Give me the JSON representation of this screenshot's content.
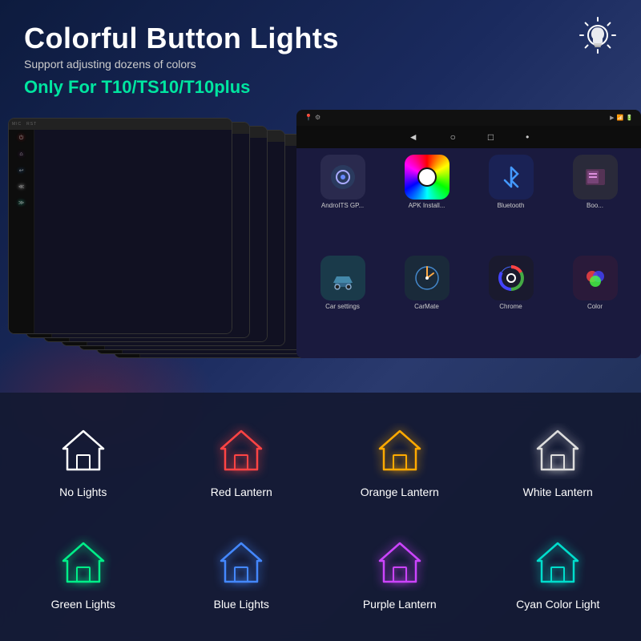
{
  "header": {
    "title": "Colorful Button Lights",
    "subtitle": "Support adjusting dozens of colors",
    "compatible": "Only For T10/TS10/T10plus"
  },
  "lights": [
    {
      "id": "no-lights",
      "label": "No Lights",
      "color": "#ffffff",
      "row": 1
    },
    {
      "id": "red-lantern",
      "label": "Red Lantern",
      "color": "#ff4444",
      "row": 1
    },
    {
      "id": "orange-lantern",
      "label": "Orange Lantern",
      "color": "#ffaa00",
      "row": 1
    },
    {
      "id": "white-lantern",
      "label": "White Lantern",
      "color": "#dddddd",
      "row": 1
    },
    {
      "id": "green-lights",
      "label": "Green Lights",
      "color": "#00ee88",
      "row": 2
    },
    {
      "id": "blue-lights",
      "label": "Blue Lights",
      "color": "#4488ff",
      "row": 2
    },
    {
      "id": "purple-lantern",
      "label": "Purple Lantern",
      "color": "#cc44ff",
      "row": 2
    },
    {
      "id": "cyan-color-light",
      "label": "Cyan Color Light",
      "color": "#00ddcc",
      "row": 2
    }
  ],
  "android": {
    "nav_back": "◄",
    "nav_home": "○",
    "nav_recent": "□",
    "nav_dot": "•",
    "apps": [
      {
        "label": "AndroITS GP...",
        "bg": "#1a1a2e",
        "emoji": "⚙"
      },
      {
        "label": "APK Install...",
        "bg": "#2a4a2a",
        "emoji": "🤖"
      },
      {
        "label": "Bluetooth",
        "bg": "#1a2a4a",
        "emoji": "⬡"
      },
      {
        "label": "Boo...",
        "bg": "#2a2a2a",
        "emoji": "📚"
      },
      {
        "label": "Car settings",
        "bg": "#1a3a4a",
        "emoji": "🚗"
      },
      {
        "label": "CarMate",
        "bg": "#1a2a3a",
        "emoji": "🗺"
      },
      {
        "label": "Chrome",
        "bg": "#1a1a2e",
        "emoji": "⊙"
      },
      {
        "label": "Color",
        "bg": "#2a1a3a",
        "emoji": "🎨"
      }
    ]
  },
  "colors": {
    "accent_green": "#00e5a0",
    "bg_dark": "#0d1b3e"
  }
}
